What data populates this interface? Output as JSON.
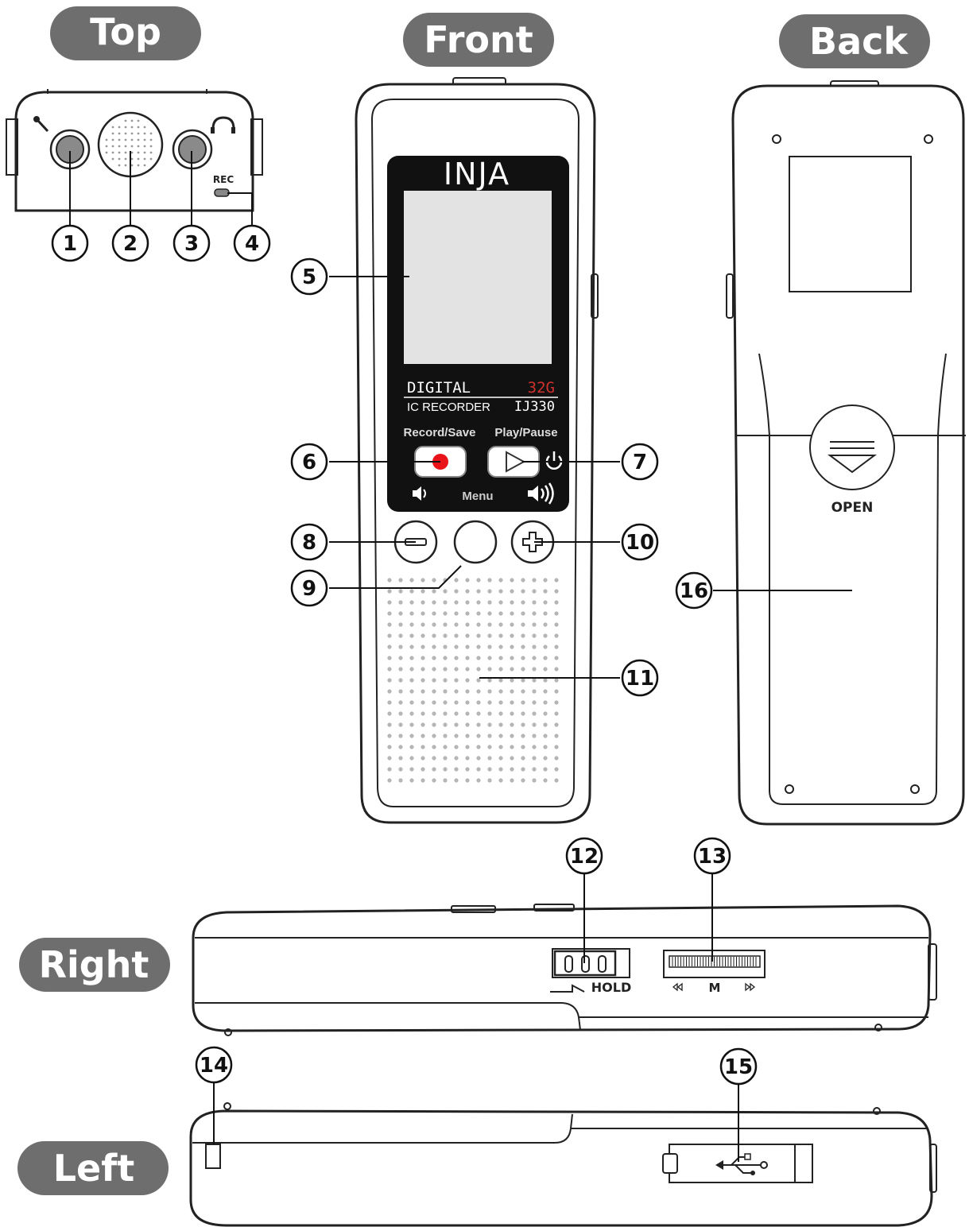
{
  "views": {
    "top": "Top",
    "front": "Front",
    "back": "Back",
    "right": "Right",
    "left": "Left"
  },
  "device": {
    "brand": "INJA",
    "line1": "DIGITAL",
    "capacity": "32G",
    "line2": "IC RECORDER",
    "model": "IJ330",
    "record_label": "Record/Save",
    "play_label": "Play/Pause",
    "menu_label": "Menu",
    "rec_led": "REC",
    "open_label": "OPEN",
    "hold_label": "HOLD",
    "wheel_label": "M"
  },
  "callouts": [
    "1",
    "2",
    "3",
    "4",
    "5",
    "6",
    "7",
    "8",
    "9",
    "10",
    "11",
    "12",
    "13",
    "14",
    "15",
    "16"
  ],
  "colors": {
    "pill": "#6e6e6e",
    "screen": "#e3e3e3",
    "panel": "#111111",
    "record_dot": "#e8141a",
    "capacity": "#d0312d"
  }
}
